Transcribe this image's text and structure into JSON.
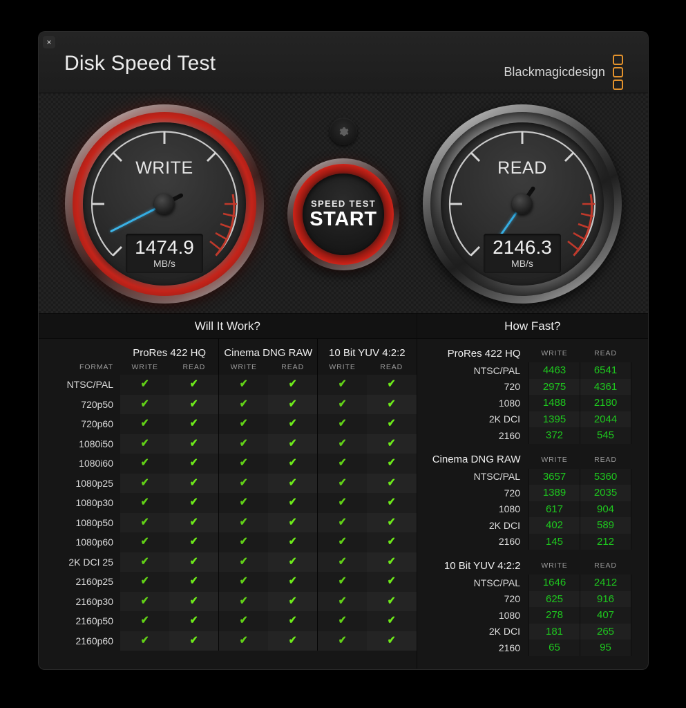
{
  "window": {
    "close_label": "×",
    "title": "Disk Speed Test",
    "brand": "Blackmagicdesign"
  },
  "gauges": {
    "write": {
      "label": "WRITE",
      "value": "1474.9",
      "unit": "MB/s",
      "needle_deg": 243
    },
    "read": {
      "label": "READ",
      "value": "2146.3",
      "unit": "MB/s",
      "needle_deg": 215
    }
  },
  "start_button": {
    "sub_label": "SPEED TEST",
    "main_label": "START"
  },
  "gear_button": {
    "icon": "gear-icon"
  },
  "will_it_work": {
    "title": "Will It Work?",
    "format_header": "FORMAT",
    "groups": [
      {
        "name": "ProRes 422 HQ",
        "columns": [
          "WRITE",
          "READ"
        ]
      },
      {
        "name": "Cinema DNG RAW",
        "columns": [
          "WRITE",
          "READ"
        ]
      },
      {
        "name": "10 Bit YUV 4:2:2",
        "columns": [
          "WRITE",
          "READ"
        ]
      }
    ],
    "check_glyph": "✔",
    "rows": [
      {
        "format": "NTSC/PAL",
        "cells": [
          true,
          true,
          true,
          true,
          true,
          true
        ]
      },
      {
        "format": "720p50",
        "cells": [
          true,
          true,
          true,
          true,
          true,
          true
        ]
      },
      {
        "format": "720p60",
        "cells": [
          true,
          true,
          true,
          true,
          true,
          true
        ]
      },
      {
        "format": "1080i50",
        "cells": [
          true,
          true,
          true,
          true,
          true,
          true
        ]
      },
      {
        "format": "1080i60",
        "cells": [
          true,
          true,
          true,
          true,
          true,
          true
        ]
      },
      {
        "format": "1080p25",
        "cells": [
          true,
          true,
          true,
          true,
          true,
          true
        ]
      },
      {
        "format": "1080p30",
        "cells": [
          true,
          true,
          true,
          true,
          true,
          true
        ]
      },
      {
        "format": "1080p50",
        "cells": [
          true,
          true,
          true,
          true,
          true,
          true
        ]
      },
      {
        "format": "1080p60",
        "cells": [
          true,
          true,
          true,
          true,
          true,
          true
        ]
      },
      {
        "format": "2K DCI 25",
        "cells": [
          true,
          true,
          true,
          true,
          true,
          true
        ]
      },
      {
        "format": "2160p25",
        "cells": [
          true,
          true,
          true,
          true,
          true,
          true
        ]
      },
      {
        "format": "2160p30",
        "cells": [
          true,
          true,
          true,
          true,
          true,
          true
        ]
      },
      {
        "format": "2160p50",
        "cells": [
          true,
          true,
          true,
          true,
          true,
          true
        ]
      },
      {
        "format": "2160p60",
        "cells": [
          true,
          true,
          true,
          true,
          true,
          true
        ]
      }
    ]
  },
  "how_fast": {
    "title": "How Fast?",
    "sections": [
      {
        "name": "ProRes 422 HQ",
        "columns": [
          "WRITE",
          "READ"
        ],
        "rows": [
          {
            "label": "NTSC/PAL",
            "write": "4463",
            "read": "6541"
          },
          {
            "label": "720",
            "write": "2975",
            "read": "4361"
          },
          {
            "label": "1080",
            "write": "1488",
            "read": "2180"
          },
          {
            "label": "2K DCI",
            "write": "1395",
            "read": "2044"
          },
          {
            "label": "2160",
            "write": "372",
            "read": "545"
          }
        ]
      },
      {
        "name": "Cinema DNG RAW",
        "columns": [
          "WRITE",
          "READ"
        ],
        "rows": [
          {
            "label": "NTSC/PAL",
            "write": "3657",
            "read": "5360"
          },
          {
            "label": "720",
            "write": "1389",
            "read": "2035"
          },
          {
            "label": "1080",
            "write": "617",
            "read": "904"
          },
          {
            "label": "2K DCI",
            "write": "402",
            "read": "589"
          },
          {
            "label": "2160",
            "write": "145",
            "read": "212"
          }
        ]
      },
      {
        "name": "10 Bit YUV 4:2:2",
        "columns": [
          "WRITE",
          "READ"
        ],
        "rows": [
          {
            "label": "NTSC/PAL",
            "write": "1646",
            "read": "2412"
          },
          {
            "label": "720",
            "write": "625",
            "read": "916"
          },
          {
            "label": "1080",
            "write": "278",
            "read": "407"
          },
          {
            "label": "2K DCI",
            "write": "181",
            "read": "265"
          },
          {
            "label": "2160",
            "write": "65",
            "read": "95"
          }
        ]
      }
    ]
  },
  "colors": {
    "check_green": "#62d117",
    "value_green": "#1ec71e",
    "brand_orange": "#e3922c",
    "needle_blue": "#2da6dd",
    "redzone": "#c4241a"
  }
}
